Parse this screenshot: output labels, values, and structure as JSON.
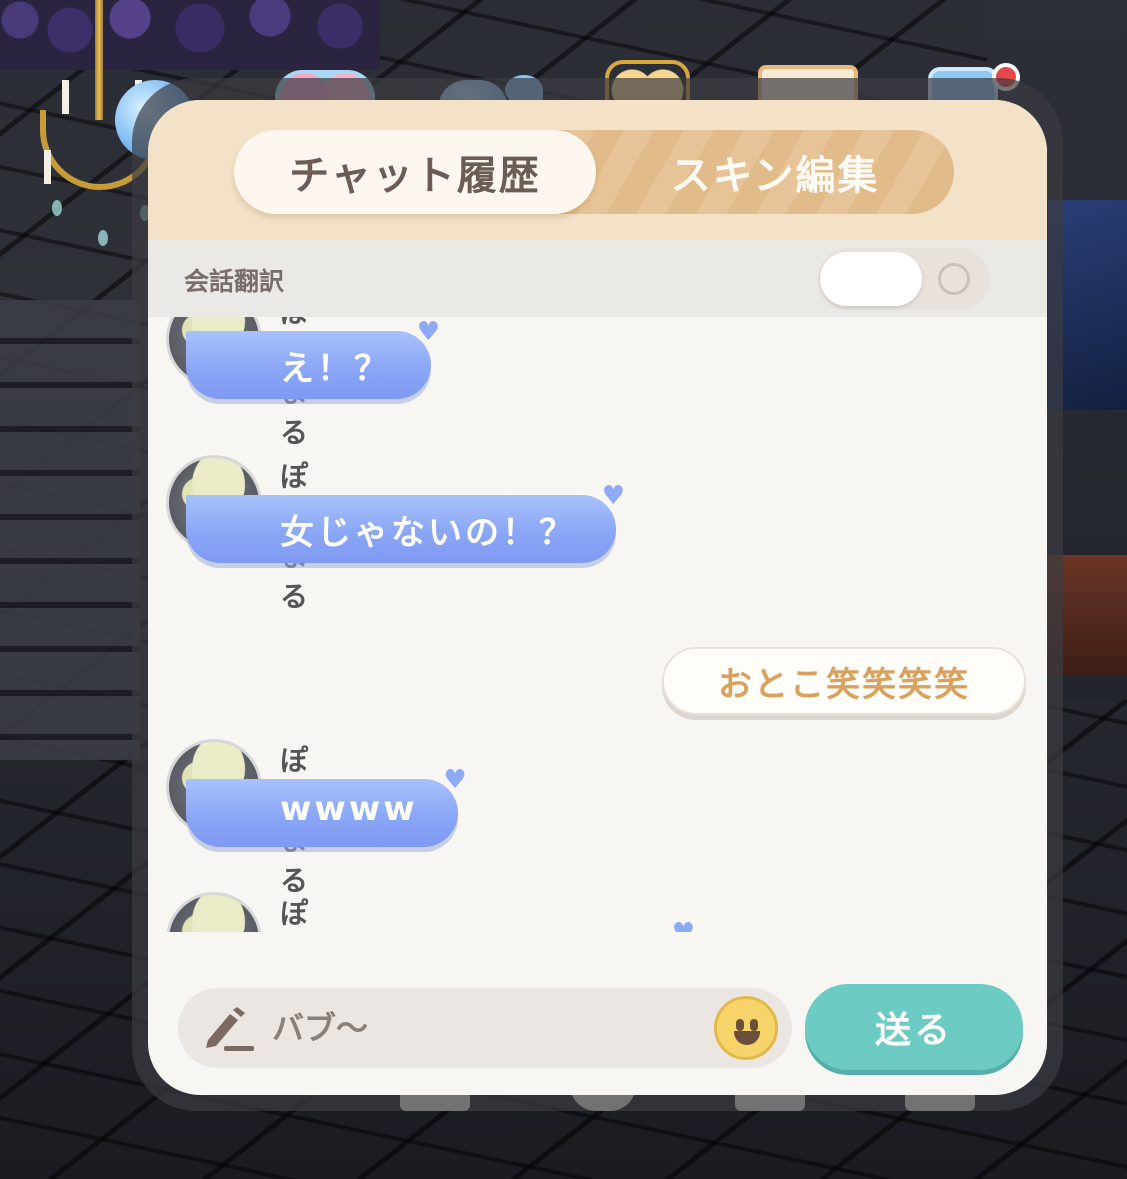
{
  "tabs": [
    {
      "label": "チャット履歴",
      "active": true
    },
    {
      "label": "スキン編集",
      "active": false
    }
  ],
  "translation": {
    "label": "会話翻訳",
    "enabled": false
  },
  "messages": [
    {
      "sender": "ぽてまる",
      "text": "え！？",
      "from_me": false
    },
    {
      "sender": "ぽてまる",
      "text": "女じゃないの！？",
      "from_me": false
    },
    {
      "sender": "",
      "text": "おとこ笑笑笑笑",
      "from_me": true
    },
    {
      "sender": "ぽてまる",
      "text": "wwww",
      "from_me": false
    },
    {
      "sender": "ぽてまる",
      "text": "",
      "from_me": false
    }
  ],
  "input": {
    "placeholder": "バブ〜",
    "value": ""
  },
  "send_label": "送る",
  "icons": {
    "pencil": "pencil-icon",
    "emoji": "smiley-icon",
    "heart": "heart-icon"
  },
  "colors": {
    "bubble_other": "#8aa6f6",
    "bubble_me_text": "#d8a15e",
    "send_button": "#6ccbc2",
    "header": "#f3e2c8",
    "notification": "#e8474b"
  }
}
